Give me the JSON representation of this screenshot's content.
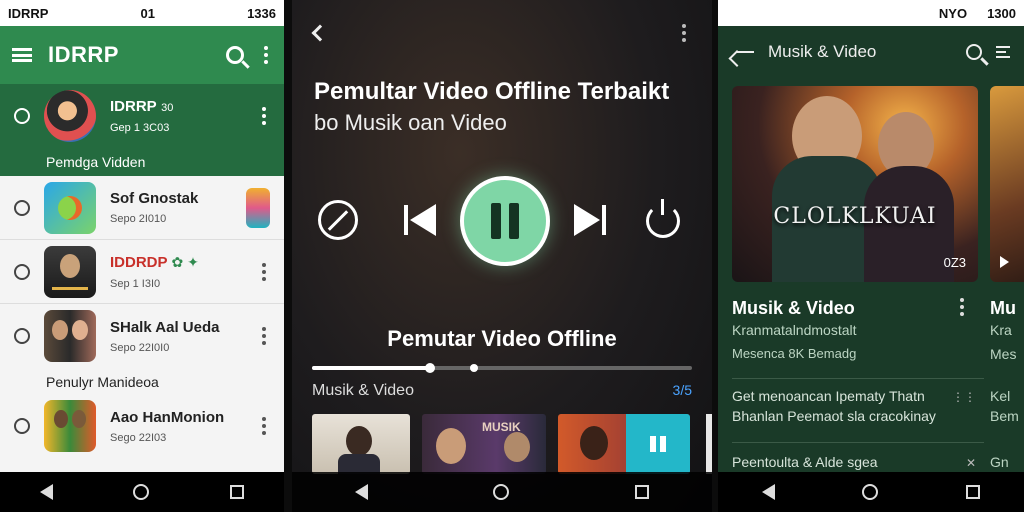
{
  "panel1": {
    "status": {
      "left": "IDRRP",
      "right": "1336",
      "mid": "01"
    },
    "appbar": {
      "title": "IDRRP"
    },
    "top_item": {
      "title": "IDRRP",
      "badge": "30",
      "subtitle": "Gep 1 3C03"
    },
    "section_green": "Pemdga Vidden",
    "items": [
      {
        "title": "Sof Gnostak",
        "subtitle": "Sepo 2I010"
      },
      {
        "title": "IDDRDP",
        "subtitle": "Sep 1 I3I0"
      },
      {
        "title": "SHalk Aal Ueda",
        "subtitle": "Sepo 22I0I0"
      }
    ],
    "section2": "Penulyr Manideoa",
    "last_item": {
      "title": "Aao HanMonion",
      "subtitle": "Sego 22I03"
    }
  },
  "panel2": {
    "title_line1": "Pemultar Video Offline Terbaikt",
    "title_line2": "bo Musik oan Video",
    "now_playing": "Pemutar Video Offline",
    "progress": 0.31,
    "section": "Musik & Video",
    "count": "3/5",
    "tile2_label": "MUSIK"
  },
  "panel3": {
    "status": {
      "right": "1300",
      "mid": "NYO"
    },
    "appbar": {
      "title": "Musik & Video"
    },
    "card": {
      "overlay": "CLOLKLKUAI",
      "duration": "0Z3"
    },
    "card_title": "Musik & Video",
    "card_sub1": "Kranmatalndmostalt",
    "card_sub2": "Mesenca 8K Bemadg",
    "right_title": "Mu",
    "right_sub1": "Kra",
    "right_sub2": "Mes",
    "right_items": [
      "Kel",
      "Bem",
      "Gn"
    ],
    "list": [
      {
        "line1": "Get menoancan Ipematy Thatn",
        "line2": "Bhanlan Peemaot sla cracokinay"
      },
      {
        "line1": "Peentoulta & Alde sgea"
      }
    ]
  },
  "colors": {
    "green_primary": "#2f8a4f",
    "green_dark": "#246b3f",
    "play_accent": "#7fd6a6",
    "panel3_bg": "#1a3a28",
    "count_blue": "#4aa3ff"
  }
}
